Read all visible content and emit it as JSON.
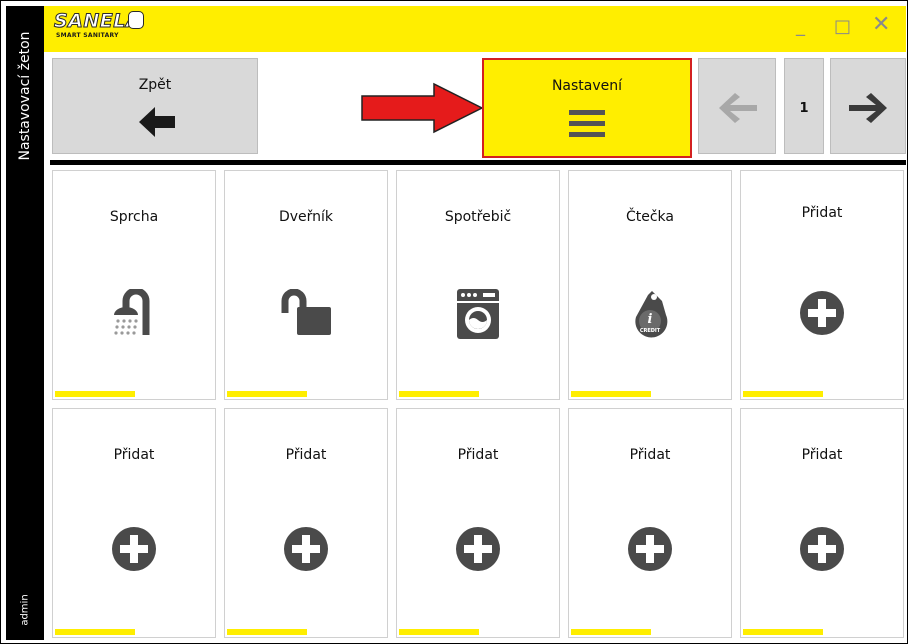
{
  "sidebar": {
    "title": "Nastavovací žeton",
    "user": "admin"
  },
  "logo": {
    "word": "SANELA",
    "tagline": "SMART SANITARY"
  },
  "window_controls": {
    "minimize": "_",
    "maximize": "□",
    "close": "✕"
  },
  "toolbar": {
    "back_label": "Zpět",
    "settings_label": "Nastavení",
    "page_number": "1"
  },
  "tiles": [
    {
      "label": "Sprcha",
      "icon": "shower-icon"
    },
    {
      "label": "Dveřník",
      "icon": "unlocked-padlock-icon"
    },
    {
      "label": "Spotřebič",
      "icon": "washing-machine-icon"
    },
    {
      "label": "Čtečka",
      "icon": "credit-token-icon"
    },
    {
      "label": "Přidat",
      "icon": "add-icon"
    },
    {
      "label": "Přidat",
      "icon": "add-icon"
    },
    {
      "label": "Přidat",
      "icon": "add-icon"
    },
    {
      "label": "Přidat",
      "icon": "add-icon"
    },
    {
      "label": "Přidat",
      "icon": "add-icon"
    },
    {
      "label": "Přidat",
      "icon": "add-icon"
    }
  ],
  "colors": {
    "accent_yellow": "#ffee00",
    "highlight_red": "#d32020",
    "icon_dark": "#4a4a4a"
  }
}
